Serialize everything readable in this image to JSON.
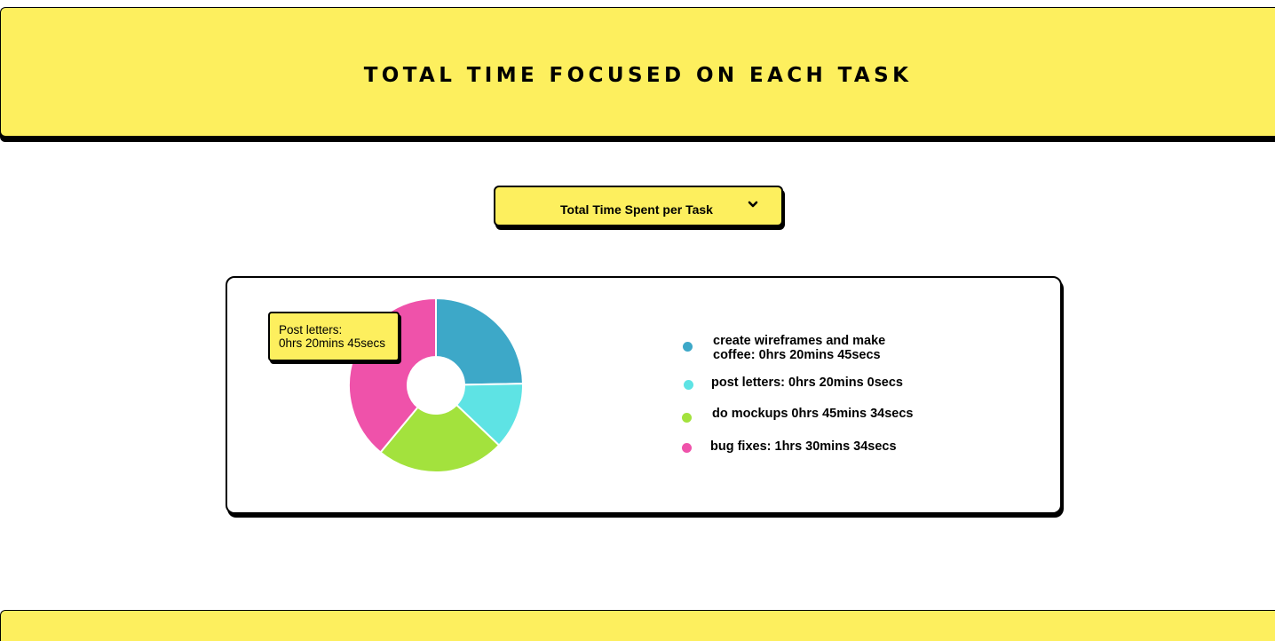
{
  "header": {
    "title": "TOTAL TIME FOCUSED ON EACH TASK"
  },
  "view_select": {
    "value": "Total Time Spent per Task",
    "icon": "chevron-down-icon"
  },
  "tooltip": {
    "line1": "Post letters:",
    "line2": "0hrs 20mins 45secs"
  },
  "legend": {
    "items": [
      {
        "line1": "create wireframes and make",
        "line2": "coffee: 0hrs 20mins 45secs",
        "color": "#3da8c8"
      },
      {
        "line1": "post letters: 0hrs 20mins 0secs",
        "line2": "",
        "color": "#5ee3e4"
      },
      {
        "line1": "do mockups 0hrs 45mins 34secs",
        "line2": "",
        "color": "#a3e23d"
      },
      {
        "line1": "bug fixes: 1hrs 30mins 34secs",
        "line2": "",
        "color": "#ef52aa"
      }
    ]
  },
  "colors": {
    "accent_yellow": "#fdef5e",
    "border": "#000000"
  },
  "chart_data": {
    "type": "pie",
    "variant": "donut",
    "legend_position": "right",
    "categories": [
      "create wireframes and make coffee",
      "post letters",
      "do mockups",
      "bug fixes"
    ],
    "values": [
      24.7,
      12.4,
      23.9,
      39.0
    ],
    "unit": "% of total time",
    "colors": [
      "#3da8c8",
      "#5ee3e4",
      "#a3e23d",
      "#ef52aa"
    ]
  }
}
